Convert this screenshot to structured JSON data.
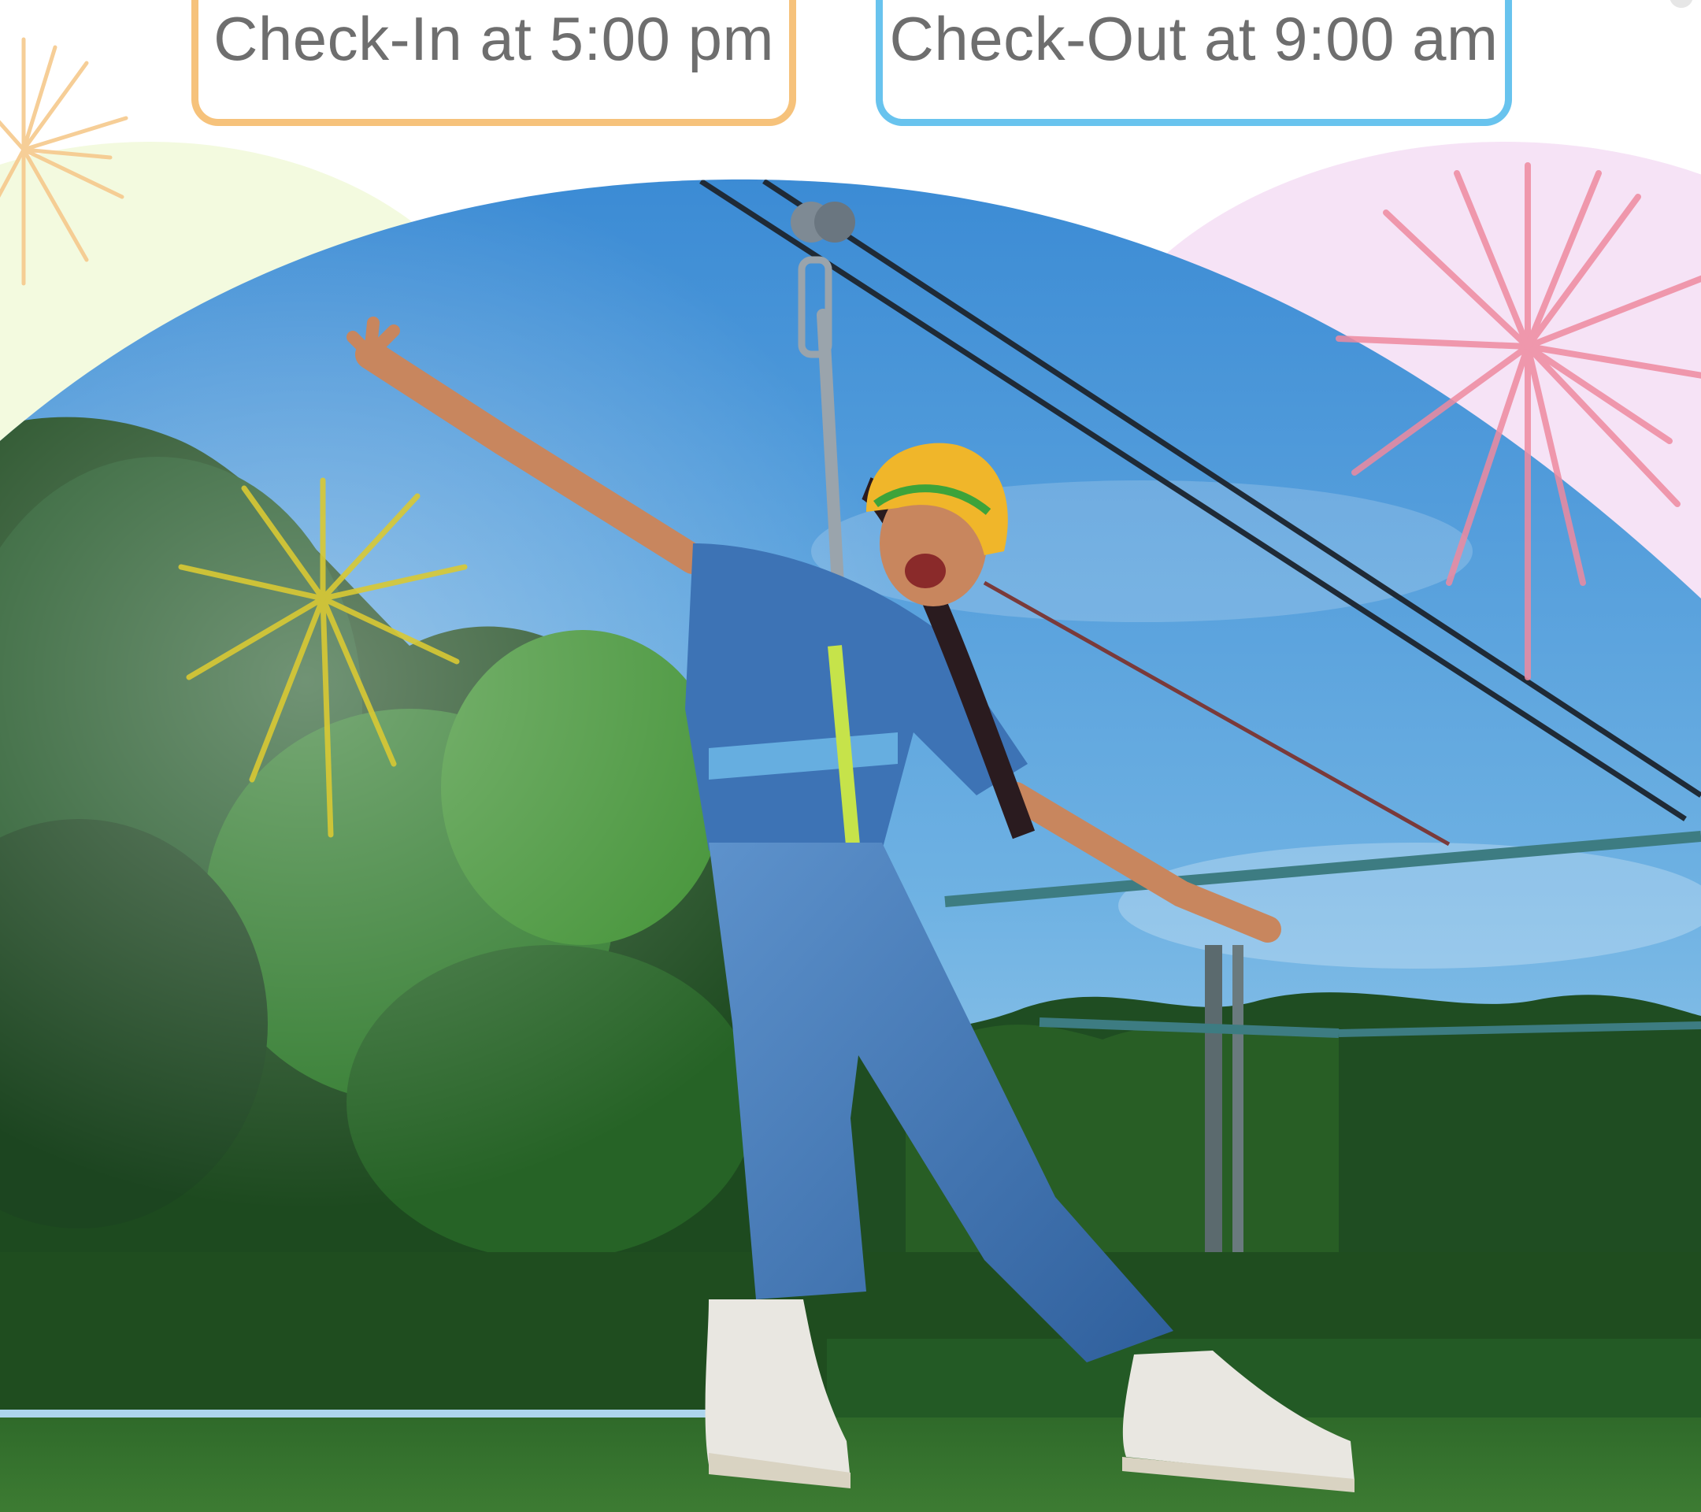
{
  "checkin": {
    "label": "Check-In at 5:00 pm",
    "border_color": "#f6c27b"
  },
  "checkout": {
    "label": "Check-Out at 9:00 am",
    "border_color": "#68c3ee"
  },
  "colors": {
    "sky_top": "#3f8ed6",
    "sky_bottom": "#a9d4ee",
    "grass": "#2f6a2a",
    "tree_dark": "#1d4a1f",
    "tree_light": "#3c8f2f",
    "denim": "#3b6fb0",
    "helmet": "#f0b62a",
    "pastel_green": "#f3fadf",
    "pastel_pink": "#f6e3f6"
  },
  "icons": [
    "firework-peach",
    "firework-pink",
    "firework-yellow"
  ]
}
